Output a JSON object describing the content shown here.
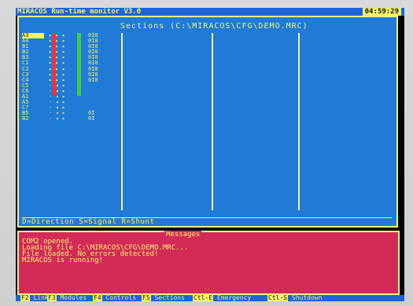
{
  "title": {
    "app": "MIRACOS Run-time monitor V3.0",
    "clock": "04:59:29"
  },
  "sections": {
    "title": "Sections (C:\\MIRACOS\\CFG\\DEMO.MRC)",
    "tags": [
      "A3",
      "A4",
      "B1",
      "B2",
      "B3",
      "C1",
      "C2",
      "C3",
      "C4",
      "C5",
      "C6",
      "A1",
      "A5",
      "C7",
      "B5",
      "B2"
    ],
    "io_values": [
      "0I0",
      "0I0",
      "0I0",
      "0I0",
      "0I0",
      "0I0",
      "0I0",
      "0I0",
      "0I0",
      "",
      "",
      "",
      "",
      "",
      "0I",
      "0I"
    ],
    "legend": "D=Direction  S=Signal  R=Shunt"
  },
  "messages": {
    "title": "Messages",
    "lines": [
      "COM2 opened.",
      "Loading file C:\\MIRACOS\\CFG\\DEMO.MRC...",
      "File loaded. No errors detected!",
      "MIRACOS is running!"
    ]
  },
  "bottom_bar": [
    {
      "key": "F2",
      "label": "Link"
    },
    {
      "key": "F3",
      "label": "Modules"
    },
    {
      "key": "F4",
      "label": "Controls"
    },
    {
      "key": "F5",
      "label": "Sections"
    },
    {
      "key": "Ctl-E",
      "label": "Emergency"
    },
    {
      "key": "Ctl-S",
      "label": "Shutdown"
    }
  ],
  "colors": {
    "main_bg": "#1f7bd6",
    "title_bg": "#1f63d6",
    "message_bg": "#d22b57",
    "text_yellow": "#f3f36a",
    "border": "#f5f08b"
  }
}
